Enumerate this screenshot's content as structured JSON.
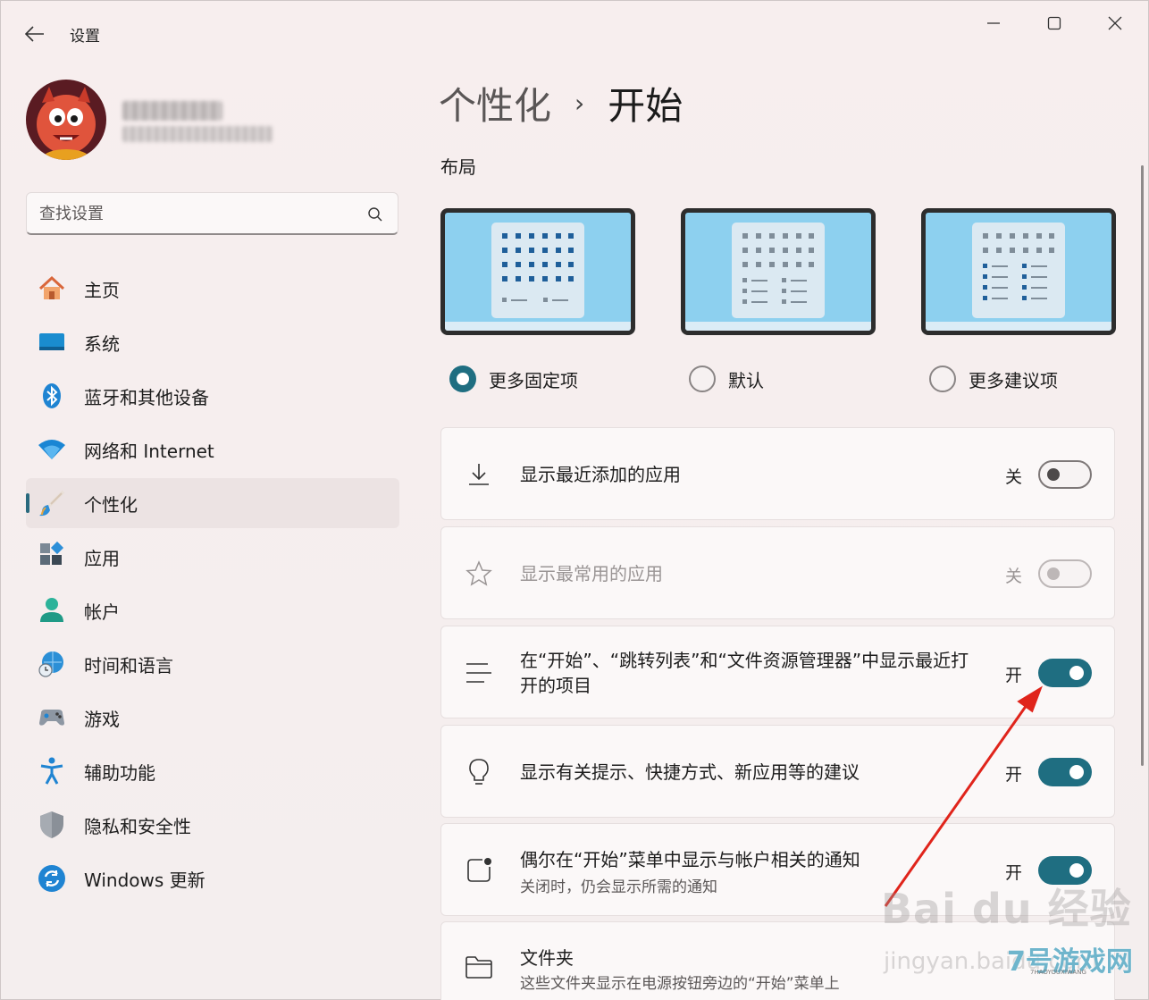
{
  "window": {
    "title": "设置",
    "minimize_icon": "minimize-icon",
    "maximize_icon": "maximize-icon",
    "close_icon": "close-icon"
  },
  "search": {
    "placeholder": "查找设置"
  },
  "sidebar": {
    "items": [
      {
        "label": "主页",
        "icon": "home-icon"
      },
      {
        "label": "系统",
        "icon": "system-icon"
      },
      {
        "label": "蓝牙和其他设备",
        "icon": "bluetooth-icon"
      },
      {
        "label": "网络和 Internet",
        "icon": "wifi-icon"
      },
      {
        "label": "个性化",
        "icon": "brush-icon",
        "active": true
      },
      {
        "label": "应用",
        "icon": "apps-icon"
      },
      {
        "label": "帐户",
        "icon": "account-icon"
      },
      {
        "label": "时间和语言",
        "icon": "globe-clock-icon"
      },
      {
        "label": "游戏",
        "icon": "gamepad-icon"
      },
      {
        "label": "辅助功能",
        "icon": "accessibility-icon"
      },
      {
        "label": "隐私和安全性",
        "icon": "shield-icon"
      },
      {
        "label": "Windows 更新",
        "icon": "update-icon"
      }
    ]
  },
  "breadcrumb": {
    "parent": "个性化",
    "separator": "›",
    "current": "开始"
  },
  "layout": {
    "title": "布局",
    "options": [
      {
        "label": "更多固定项",
        "selected": true
      },
      {
        "label": "默认",
        "selected": false
      },
      {
        "label": "更多建议项",
        "selected": false
      }
    ]
  },
  "settings": [
    {
      "title": "显示最近添加的应用",
      "state": "关",
      "on": false,
      "disabled": false,
      "icon": "download-icon"
    },
    {
      "title": "显示最常用的应用",
      "state": "关",
      "on": false,
      "disabled": true,
      "icon": "star-icon"
    },
    {
      "title_line1": "在“开始”、“跳转列表”和“文件资源管理器”中显示最近打",
      "title_line2": "开的项目",
      "state": "开",
      "on": true,
      "disabled": false,
      "icon": "list-icon"
    },
    {
      "title": "显示有关提示、快捷方式、新应用等的建议",
      "state": "开",
      "on": true,
      "disabled": false,
      "icon": "lightbulb-icon"
    },
    {
      "title": "偶尔在“开始”菜单中显示与帐户相关的通知",
      "subtitle": "关闭时，仍会显示所需的通知",
      "state": "开",
      "on": true,
      "disabled": false,
      "icon": "notification-icon"
    },
    {
      "title": "文件夹",
      "subtitle": "这些文件夹显示在电源按钮旁边的“开始”菜单上",
      "icon": "folder-icon"
    }
  ],
  "watermarks": {
    "baidu": "Bai du 经验",
    "jingyan": "jingyan.baidu.com",
    "site": "7号游戏网",
    "site_sub": "7HAOYOUXIWANG"
  },
  "colors": {
    "accent": "#1f6e81",
    "annotation_arrow": "#e0241b"
  }
}
